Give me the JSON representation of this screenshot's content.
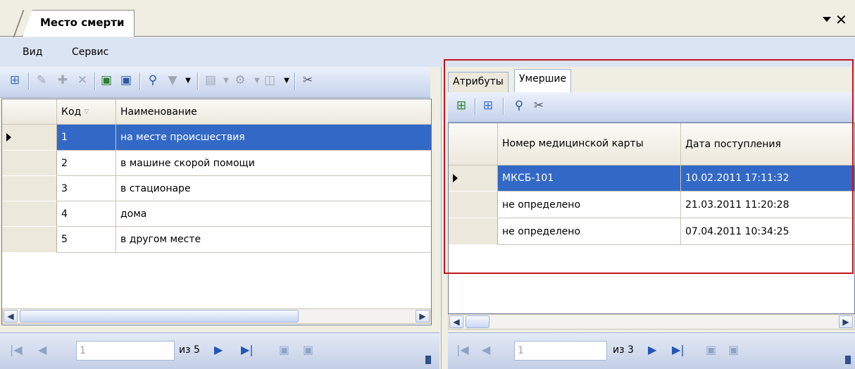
{
  "window": {
    "title": "Место смерти"
  },
  "menu": {
    "items": [
      "Вид",
      "Сервис"
    ]
  },
  "left": {
    "columns": [
      "Код",
      "Наименование"
    ],
    "rows": [
      {
        "code": "1",
        "name": "на месте происшествия"
      },
      {
        "code": "2",
        "name": "в машине скорой помощи"
      },
      {
        "code": "3",
        "name": "в стационаре"
      },
      {
        "code": "4",
        "name": "дома"
      },
      {
        "code": "5",
        "name": "в другом месте"
      }
    ],
    "nav": {
      "page": "1",
      "of": "из 5"
    }
  },
  "right": {
    "tabs": [
      "Атрибуты",
      "Умершие"
    ],
    "active_tab": "Умершие",
    "columns": [
      "Номер медицинской карты",
      "Дата поступления"
    ],
    "rows": [
      {
        "card": "МКСБ-101",
        "date": "10.02.2011 17:11:32"
      },
      {
        "card": "не определено",
        "date": "21.03.2011 11:20:28"
      },
      {
        "card": "не определено",
        "date": "07.04.2011 10:34:25"
      }
    ],
    "nav": {
      "page": "1",
      "of": "из 3"
    }
  },
  "colors": {
    "selection": "#3369c6",
    "highlight_box": "#c0141c",
    "toolbar": "#c4d2ec"
  }
}
